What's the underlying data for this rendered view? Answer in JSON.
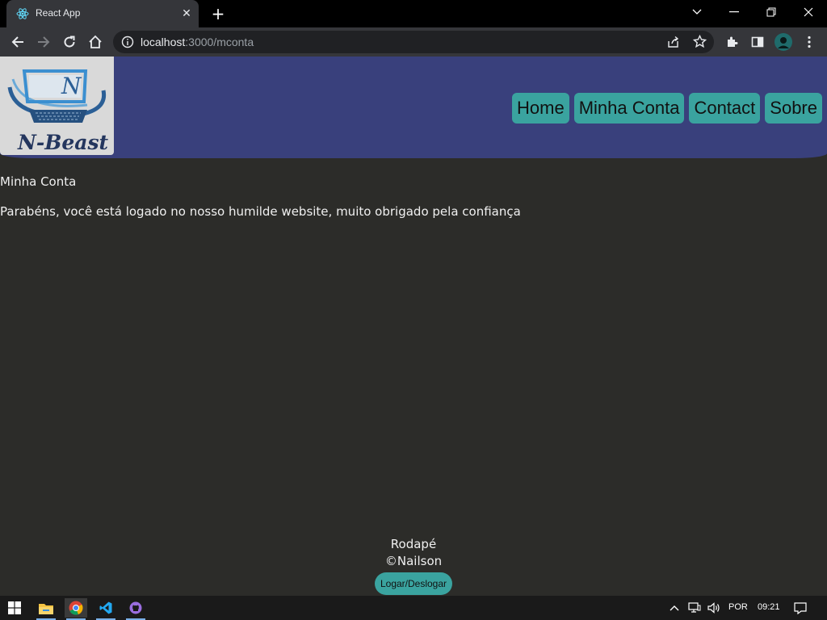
{
  "browser": {
    "tab_title": "React App",
    "url_host": "localhost",
    "url_path": ":3000/mconta"
  },
  "site": {
    "logo_text": "N-Beast",
    "logo_letter": "N",
    "nav": [
      {
        "label": "Home"
      },
      {
        "label": "Minha Conta"
      },
      {
        "label": "Contact"
      },
      {
        "label": "Sobre"
      }
    ],
    "page_title": "Minha Conta",
    "message": "Parabéns, você está logado no nosso humilde website, muito obrigado pela confiança",
    "footer": {
      "line1": "Rodapé",
      "line2": "©Nailson",
      "button": "Logar/Deslogar"
    },
    "colors": {
      "navbar": "#39407c",
      "accent": "#3aa39f",
      "background": "#2c2c29"
    }
  },
  "taskbar": {
    "language": "POR",
    "time": "09:21"
  }
}
